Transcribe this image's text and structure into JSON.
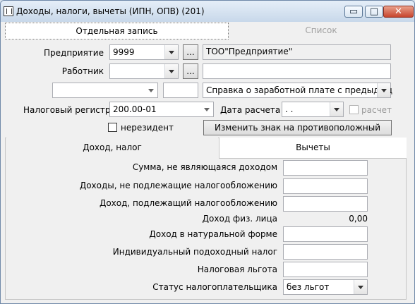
{
  "window": {
    "title": "Доходы, налоги, вычеты (ИПН, ОПВ) (201)",
    "controls": {
      "minimize": "▭",
      "maximize": "□",
      "close": "✕"
    }
  },
  "tabs": [
    "Отдельная запись",
    "Список"
  ],
  "form": {
    "enterprise": {
      "label": "Предприятие",
      "code": "9999",
      "name": "ТОО\"Предприятие\""
    },
    "employee": {
      "label": "Работник",
      "code": "",
      "name": ""
    },
    "row3": {
      "left_value": "",
      "small_value": "",
      "report_value": "Справка о заработной плате с предыдущ"
    },
    "tax_register": {
      "label": "Налоговый регистр",
      "value": "200.00-01"
    },
    "calc_date": {
      "label": "Дата расчета",
      "value": " .  ."
    },
    "calc_checkbox": {
      "label": "расчет"
    },
    "nonresident": {
      "label": "нерезидент"
    },
    "invert_button": "Изменить знак на противоположный"
  },
  "subtabs": [
    "Доход, налог",
    "Вычеты"
  ],
  "income_rows": [
    {
      "label": "Сумма, не являющаяся доходом",
      "value": ""
    },
    {
      "label": "Доходы, не подлежащие налогообложению",
      "value": ""
    },
    {
      "label": "Доход, подлежащий налогообложению",
      "value": ""
    },
    {
      "label": "Доход физ. лица",
      "value": "0,00"
    },
    {
      "label": "Доход в натуральной форме",
      "value": ""
    },
    {
      "label": "Индивидуальный подоходный налог",
      "value": ""
    },
    {
      "label": "Налоговая льгота",
      "value": ""
    },
    {
      "label": "Статус налогоплательщика",
      "value": "без льгот"
    }
  ],
  "icons": [
    "document-icon",
    "minimize-icon",
    "maximize-icon",
    "close-icon",
    "dropdown-arrow-icon"
  ]
}
